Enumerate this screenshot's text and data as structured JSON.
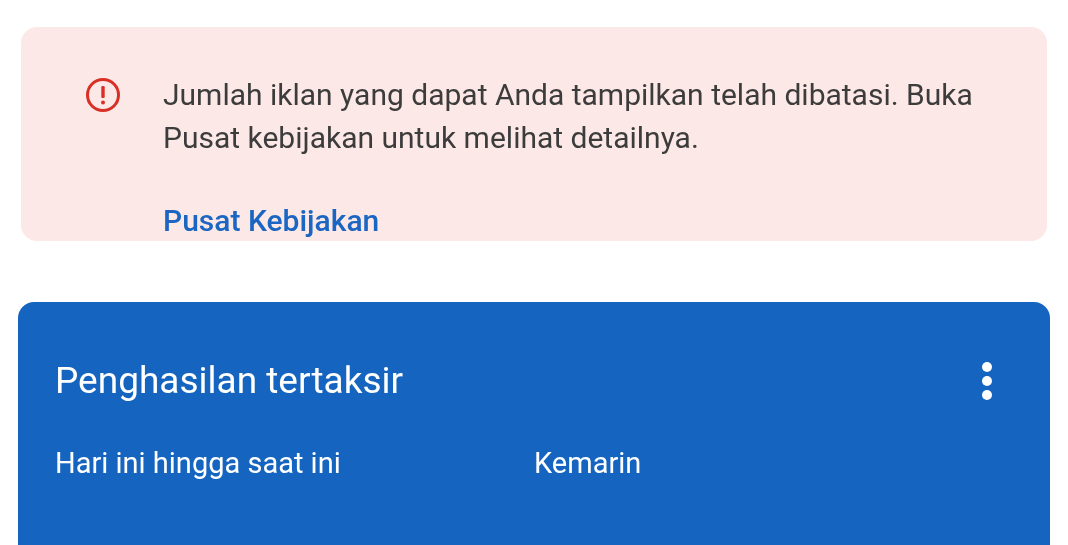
{
  "alert": {
    "message": "Jumlah iklan yang dapat Anda tampilkan telah dibatasi. Buka Pusat kebijakan untuk melihat detailnya.",
    "link": "Pusat Kebijakan"
  },
  "earnings_card": {
    "title": "Penghasilan tertaksir",
    "columns": [
      "Hari ini hingga saat ini",
      "Kemarin"
    ]
  }
}
